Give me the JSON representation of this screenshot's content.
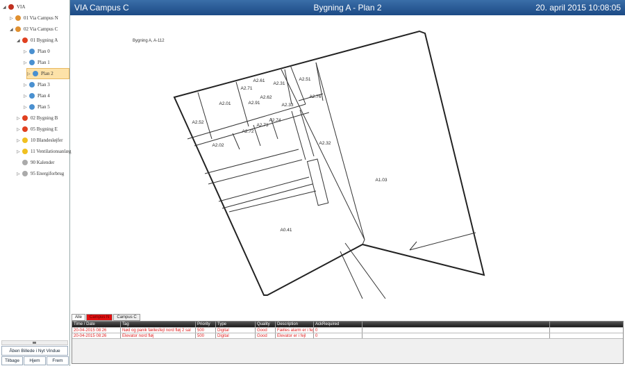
{
  "tree": [
    {
      "label": "VIA",
      "level": 0,
      "arrow": "◢",
      "icon": "factory-icon",
      "color": "#c03020"
    },
    {
      "label": "01 Via Campus N",
      "level": 1,
      "arrow": "▷",
      "icon": "campus-icon",
      "color": "#e09030"
    },
    {
      "label": "02 Via Campus C",
      "level": 1,
      "arrow": "◢",
      "icon": "campus-icon",
      "color": "#e09030"
    },
    {
      "label": "01 Bygning A",
      "level": 2,
      "arrow": "◢",
      "icon": "building-icon",
      "color": "#e04020"
    },
    {
      "label": "Plan 0",
      "level": 3,
      "arrow": "▷",
      "icon": "floor-icon",
      "color": "#4a90d0"
    },
    {
      "label": "Plan 1",
      "level": 3,
      "arrow": "▷",
      "icon": "floor-icon",
      "color": "#4a90d0"
    },
    {
      "label": "Plan 2",
      "level": 3,
      "arrow": "▷",
      "icon": "floor-icon",
      "color": "#4a90d0",
      "selected": true
    },
    {
      "label": "Plan 3",
      "level": 3,
      "arrow": "▷",
      "icon": "floor-icon",
      "color": "#4a90d0"
    },
    {
      "label": "Plan 4",
      "level": 3,
      "arrow": "▷",
      "icon": "floor-icon",
      "color": "#4a90d0"
    },
    {
      "label": "Plan 5",
      "level": 3,
      "arrow": "▷",
      "icon": "floor-icon",
      "color": "#4a90d0"
    },
    {
      "label": "02 Bygning B",
      "level": 2,
      "arrow": "▷",
      "icon": "building-icon",
      "color": "#e04020"
    },
    {
      "label": "05 Bygning E",
      "level": 2,
      "arrow": "▷",
      "icon": "building-icon",
      "color": "#e04020"
    },
    {
      "label": "10 Blandesløjfer",
      "level": 2,
      "arrow": "▷",
      "icon": "mixing-loop-icon",
      "color": "#f0c020"
    },
    {
      "label": "11 Ventilationsanlæg",
      "level": 2,
      "arrow": "▷",
      "icon": "ventilation-icon",
      "color": "#f0c020"
    },
    {
      "label": "90 Kalender",
      "level": 2,
      "arrow": "",
      "icon": "calendar-icon",
      "color": "#aaaaaa"
    },
    {
      "label": "95 Energiforbrug",
      "level": 2,
      "arrow": "▷",
      "icon": "energy-icon",
      "color": "#aaaaaa"
    }
  ],
  "sidebar_buttons": {
    "open_new": "Åben Billede i Nyt Vindue",
    "back": "Tilbage",
    "home": "Hjem",
    "forward": "Frem"
  },
  "header": {
    "left": "VIA Campus C",
    "center": "Bygning A - Plan 2",
    "right": "20. april 2015 10:08:05"
  },
  "plan": {
    "caption": "Bygning A, A-112",
    "rooms": [
      "A2.61",
      "A2.71",
      "A2.31",
      "A2.51",
      "A2.01",
      "A2.91",
      "A2.62",
      "A2.76",
      "A2.33",
      "A2.52",
      "A2.72",
      "A2.73",
      "A2.74",
      "A2.02",
      "A2.32",
      "A1.03",
      "A0.41"
    ]
  },
  "alarm_tabs": [
    "Alle",
    "Campus N",
    "Campus C"
  ],
  "alarm_columns": [
    "Time / Date",
    "Tag",
    "Priority",
    "Type",
    "Quality",
    "Description",
    "AckRequired"
  ],
  "alarms": [
    [
      "20-04-2015 08:26",
      "Nød og panik fællesfejl nord fløj 2 sal",
      "500",
      "Digital",
      "Good",
      "Fælles alarm er i fejl",
      "0"
    ],
    [
      "20-04-2015 08:26",
      "Elevator nord fløj",
      "500",
      "Digital",
      "Good",
      "Elevator er i fejl",
      "0"
    ]
  ],
  "colors": {
    "alarm": "#e02020",
    "header": "#1c4a85",
    "selection": "#fde2a8"
  }
}
